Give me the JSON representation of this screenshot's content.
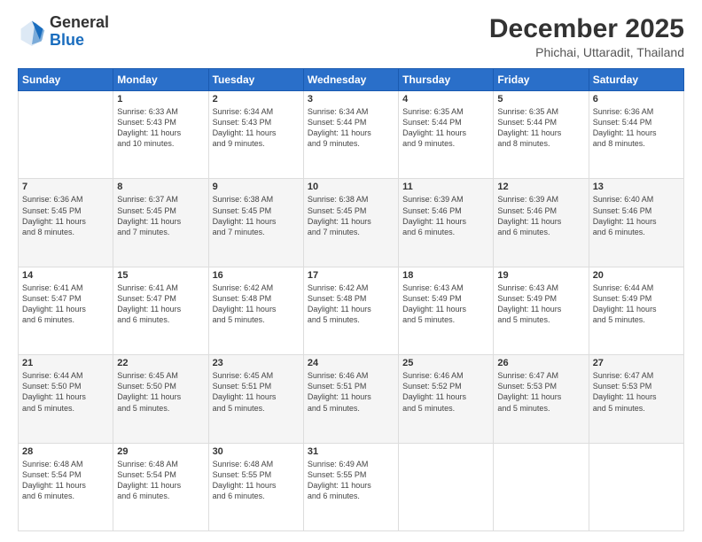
{
  "header": {
    "logo_line1": "General",
    "logo_line2": "Blue",
    "title": "December 2025",
    "subtitle": "Phichai, Uttaradit, Thailand"
  },
  "calendar": {
    "days_of_week": [
      "Sunday",
      "Monday",
      "Tuesday",
      "Wednesday",
      "Thursday",
      "Friday",
      "Saturday"
    ],
    "weeks": [
      [
        {
          "day": "",
          "info": ""
        },
        {
          "day": "1",
          "info": "Sunrise: 6:33 AM\nSunset: 5:43 PM\nDaylight: 11 hours\nand 10 minutes."
        },
        {
          "day": "2",
          "info": "Sunrise: 6:34 AM\nSunset: 5:43 PM\nDaylight: 11 hours\nand 9 minutes."
        },
        {
          "day": "3",
          "info": "Sunrise: 6:34 AM\nSunset: 5:44 PM\nDaylight: 11 hours\nand 9 minutes."
        },
        {
          "day": "4",
          "info": "Sunrise: 6:35 AM\nSunset: 5:44 PM\nDaylight: 11 hours\nand 9 minutes."
        },
        {
          "day": "5",
          "info": "Sunrise: 6:35 AM\nSunset: 5:44 PM\nDaylight: 11 hours\nand 8 minutes."
        },
        {
          "day": "6",
          "info": "Sunrise: 6:36 AM\nSunset: 5:44 PM\nDaylight: 11 hours\nand 8 minutes."
        }
      ],
      [
        {
          "day": "7",
          "info": "Sunrise: 6:36 AM\nSunset: 5:45 PM\nDaylight: 11 hours\nand 8 minutes."
        },
        {
          "day": "8",
          "info": "Sunrise: 6:37 AM\nSunset: 5:45 PM\nDaylight: 11 hours\nand 7 minutes."
        },
        {
          "day": "9",
          "info": "Sunrise: 6:38 AM\nSunset: 5:45 PM\nDaylight: 11 hours\nand 7 minutes."
        },
        {
          "day": "10",
          "info": "Sunrise: 6:38 AM\nSunset: 5:45 PM\nDaylight: 11 hours\nand 7 minutes."
        },
        {
          "day": "11",
          "info": "Sunrise: 6:39 AM\nSunset: 5:46 PM\nDaylight: 11 hours\nand 6 minutes."
        },
        {
          "day": "12",
          "info": "Sunrise: 6:39 AM\nSunset: 5:46 PM\nDaylight: 11 hours\nand 6 minutes."
        },
        {
          "day": "13",
          "info": "Sunrise: 6:40 AM\nSunset: 5:46 PM\nDaylight: 11 hours\nand 6 minutes."
        }
      ],
      [
        {
          "day": "14",
          "info": "Sunrise: 6:41 AM\nSunset: 5:47 PM\nDaylight: 11 hours\nand 6 minutes."
        },
        {
          "day": "15",
          "info": "Sunrise: 6:41 AM\nSunset: 5:47 PM\nDaylight: 11 hours\nand 6 minutes."
        },
        {
          "day": "16",
          "info": "Sunrise: 6:42 AM\nSunset: 5:48 PM\nDaylight: 11 hours\nand 5 minutes."
        },
        {
          "day": "17",
          "info": "Sunrise: 6:42 AM\nSunset: 5:48 PM\nDaylight: 11 hours\nand 5 minutes."
        },
        {
          "day": "18",
          "info": "Sunrise: 6:43 AM\nSunset: 5:49 PM\nDaylight: 11 hours\nand 5 minutes."
        },
        {
          "day": "19",
          "info": "Sunrise: 6:43 AM\nSunset: 5:49 PM\nDaylight: 11 hours\nand 5 minutes."
        },
        {
          "day": "20",
          "info": "Sunrise: 6:44 AM\nSunset: 5:49 PM\nDaylight: 11 hours\nand 5 minutes."
        }
      ],
      [
        {
          "day": "21",
          "info": "Sunrise: 6:44 AM\nSunset: 5:50 PM\nDaylight: 11 hours\nand 5 minutes."
        },
        {
          "day": "22",
          "info": "Sunrise: 6:45 AM\nSunset: 5:50 PM\nDaylight: 11 hours\nand 5 minutes."
        },
        {
          "day": "23",
          "info": "Sunrise: 6:45 AM\nSunset: 5:51 PM\nDaylight: 11 hours\nand 5 minutes."
        },
        {
          "day": "24",
          "info": "Sunrise: 6:46 AM\nSunset: 5:51 PM\nDaylight: 11 hours\nand 5 minutes."
        },
        {
          "day": "25",
          "info": "Sunrise: 6:46 AM\nSunset: 5:52 PM\nDaylight: 11 hours\nand 5 minutes."
        },
        {
          "day": "26",
          "info": "Sunrise: 6:47 AM\nSunset: 5:53 PM\nDaylight: 11 hours\nand 5 minutes."
        },
        {
          "day": "27",
          "info": "Sunrise: 6:47 AM\nSunset: 5:53 PM\nDaylight: 11 hours\nand 5 minutes."
        }
      ],
      [
        {
          "day": "28",
          "info": "Sunrise: 6:48 AM\nSunset: 5:54 PM\nDaylight: 11 hours\nand 6 minutes."
        },
        {
          "day": "29",
          "info": "Sunrise: 6:48 AM\nSunset: 5:54 PM\nDaylight: 11 hours\nand 6 minutes."
        },
        {
          "day": "30",
          "info": "Sunrise: 6:48 AM\nSunset: 5:55 PM\nDaylight: 11 hours\nand 6 minutes."
        },
        {
          "day": "31",
          "info": "Sunrise: 6:49 AM\nSunset: 5:55 PM\nDaylight: 11 hours\nand 6 minutes."
        },
        {
          "day": "",
          "info": ""
        },
        {
          "day": "",
          "info": ""
        },
        {
          "day": "",
          "info": ""
        }
      ]
    ]
  }
}
